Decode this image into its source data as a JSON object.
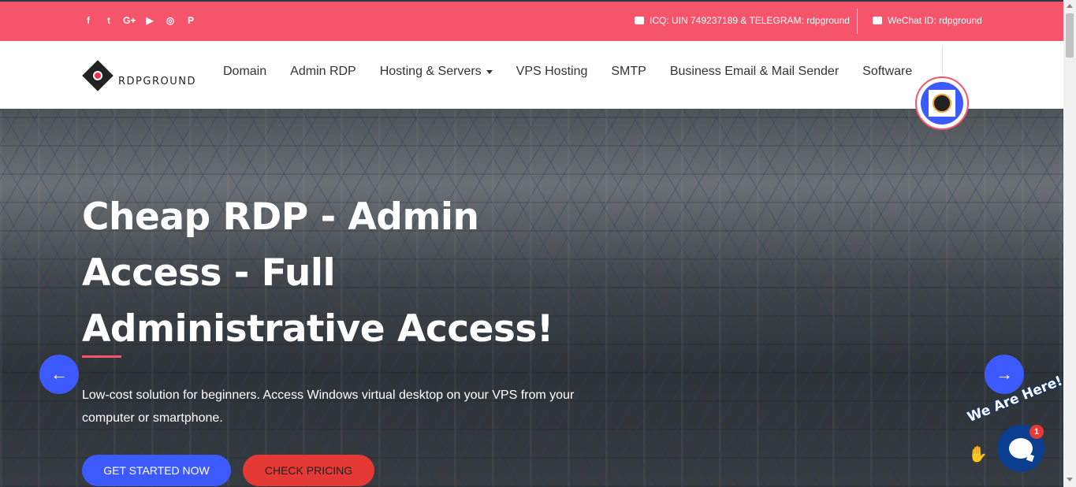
{
  "topbar": {
    "social": [
      {
        "name": "facebook-icon",
        "glyph": "f"
      },
      {
        "name": "twitter-icon",
        "glyph": "t"
      },
      {
        "name": "google-plus-icon",
        "glyph": "G+"
      },
      {
        "name": "youtube-icon",
        "glyph": "▶"
      },
      {
        "name": "instagram-icon",
        "glyph": "◎"
      },
      {
        "name": "pinterest-icon",
        "glyph": "P"
      }
    ],
    "icq_text": "ICQ: UIN 749237189 & TELEGRAM: rdpground",
    "wechat_text": "WeChat ID: rdpground",
    "color": "#f6546a"
  },
  "nav": {
    "logo_text": "RDPGROUND",
    "items": [
      {
        "label": "Domain"
      },
      {
        "label": "Admin RDP"
      },
      {
        "label": "Hosting & Servers"
      },
      {
        "label": "VPS Hosting"
      },
      {
        "label": "SMTP"
      },
      {
        "label": "Business Email & Mail Sender"
      },
      {
        "label": "Software"
      }
    ]
  },
  "hero": {
    "title": "Cheap RDP - Admin Access - Full Administrative Access!",
    "subtitle": "Low-cost solution for beginners. Access Windows virtual desktop on your VPS from your computer or smartphone.",
    "primary_button": "GET STARTED NOW",
    "secondary_button": "CHECK PRICING",
    "prev_arrow": "←",
    "next_arrow": "→",
    "accent": "#3d5afe"
  },
  "chat": {
    "banner": "We Are Here!",
    "badge_count": "1"
  }
}
